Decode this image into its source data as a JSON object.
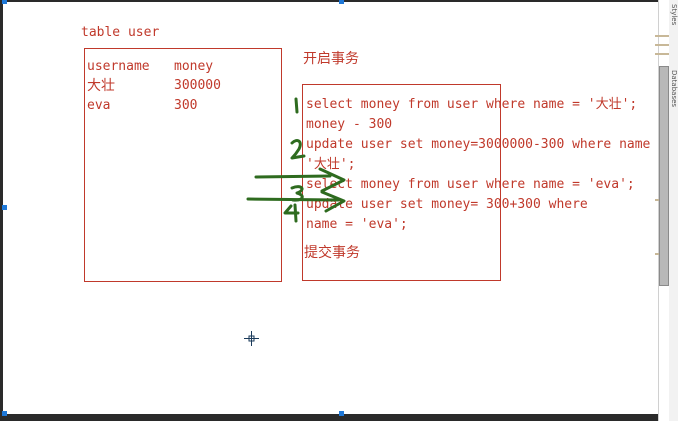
{
  "table_caption": "table user",
  "user_table": {
    "headers": [
      "username",
      "money"
    ],
    "rows": [
      [
        "大壮",
        "300000"
      ],
      [
        "eva",
        "300"
      ]
    ]
  },
  "transaction": {
    "begin": "开启事务",
    "lines": [
      "select money from user where name = '大壮';",
      "money - 300",
      "update user set money=3000000-300 where name =",
      "'大壮';",
      "select money from user where name = 'eva';",
      "update user set money= 300+300 where",
      "name = 'eva';"
    ],
    "commit": "提交事务"
  },
  "side_panel": {
    "labels": [
      "Styles",
      "Databases"
    ]
  },
  "colors": {
    "text": "#c0392b",
    "ink": "#2e6b1f",
    "selection_handle": "#1e78d8"
  }
}
